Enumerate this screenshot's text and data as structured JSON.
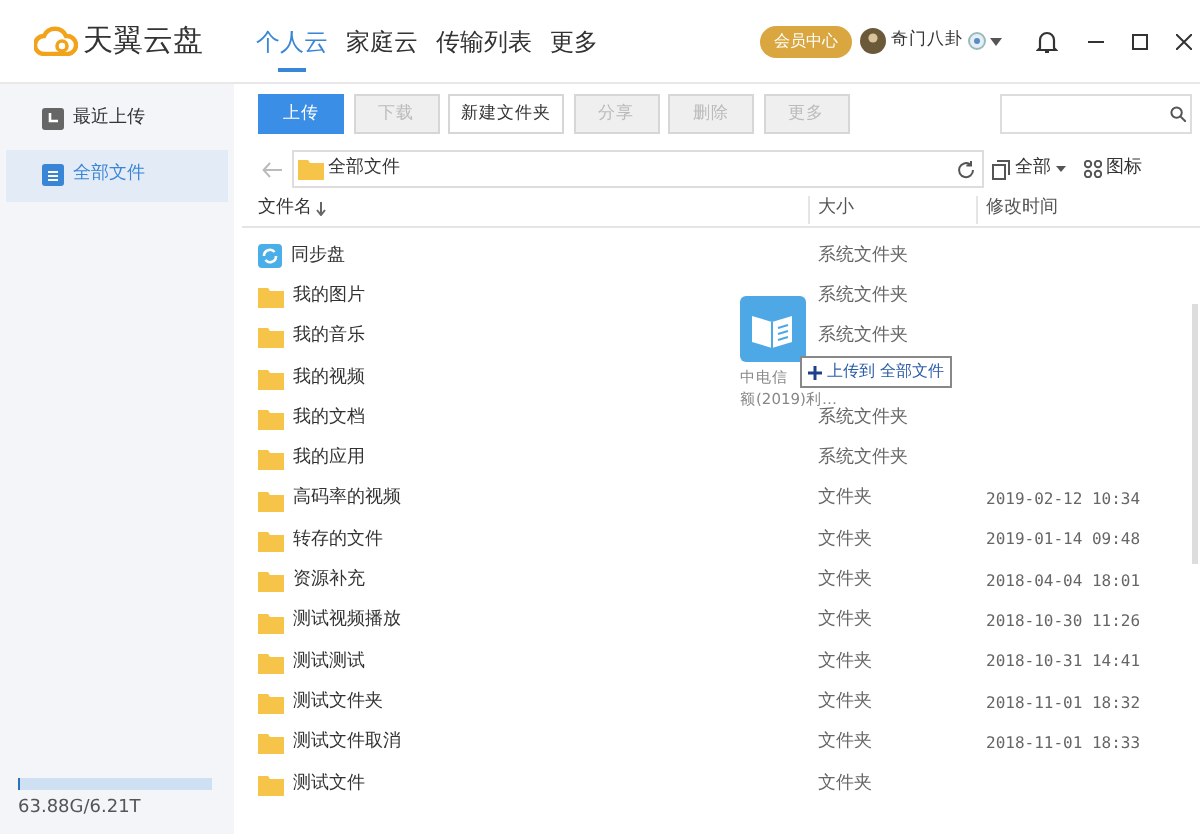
{
  "app": {
    "title": "天翼云盘"
  },
  "nav_tabs": [
    {
      "label": "个人云",
      "selected": true
    },
    {
      "label": "家庭云",
      "selected": false
    },
    {
      "label": "传输列表",
      "selected": false
    },
    {
      "label": "更多",
      "selected": false
    }
  ],
  "vip_button": "会员中心",
  "user": {
    "name": "奇门八卦"
  },
  "sidebar": {
    "items": [
      {
        "label": "最近上传",
        "kind": "recent",
        "selected": false
      },
      {
        "label": "全部文件",
        "kind": "files",
        "selected": true
      }
    ],
    "storage": {
      "level": 0.01,
      "text": "63.88G/6.21T"
    }
  },
  "toolbar": {
    "buttons": [
      {
        "label": "上传",
        "kind": "primary",
        "disabled": false
      },
      {
        "label": "下载",
        "kind": "plain",
        "disabled": true
      },
      {
        "label": "新建文件夹",
        "kind": "plain",
        "disabled": false
      },
      {
        "label": "分享",
        "kind": "plain",
        "disabled": true
      },
      {
        "label": "删除",
        "kind": "plain",
        "disabled": true
      },
      {
        "label": "更多",
        "kind": "plain",
        "disabled": true
      }
    ]
  },
  "path": "全部文件",
  "filter": "全部",
  "view": "图标",
  "table": {
    "columns": [
      {
        "label": "文件名",
        "sorted": true
      },
      {
        "label": "大小",
        "sorted": false
      },
      {
        "label": "修改时间",
        "sorted": false
      }
    ],
    "rows": [
      {
        "name": "同步盘",
        "kind": "sync",
        "size": "系统文件夹",
        "modified": ""
      },
      {
        "name": "我的图片",
        "kind": "folder",
        "size": "系统文件夹",
        "modified": ""
      },
      {
        "name": "我的音乐",
        "kind": "folder",
        "size": "系统文件夹",
        "modified": ""
      },
      {
        "name": "我的视频",
        "kind": "folder",
        "size": "",
        "modified": ""
      },
      {
        "name": "我的文档",
        "kind": "folder",
        "size": "系统文件夹",
        "modified": ""
      },
      {
        "name": "我的应用",
        "kind": "folder",
        "size": "系统文件夹",
        "modified": ""
      },
      {
        "name": "高码率的视频",
        "kind": "folder",
        "size": "文件夹",
        "modified": "2019-02-12 10:34"
      },
      {
        "name": "转存的文件",
        "kind": "folder",
        "size": "文件夹",
        "modified": "2019-01-14 09:48"
      },
      {
        "name": "资源补充",
        "kind": "folder",
        "size": "文件夹",
        "modified": "2018-04-04 18:01"
      },
      {
        "name": "测试视频播放",
        "kind": "folder",
        "size": "文件夹",
        "modified": "2018-10-30 11:26"
      },
      {
        "name": "测试测试",
        "kind": "folder",
        "size": "文件夹",
        "modified": "2018-10-31 14:41"
      },
      {
        "name": "测试文件夹",
        "kind": "folder",
        "size": "文件夹",
        "modified": "2018-11-01 18:32"
      },
      {
        "name": "测试文件取消",
        "kind": "folder",
        "size": "文件夹",
        "modified": "2018-11-01 18:33"
      },
      {
        "name": "测试文件",
        "kind": "folder",
        "size": "文件夹",
        "modified": ""
      }
    ]
  },
  "drag": {
    "label_lines": [
      "中电信",
      "额(2019)利…"
    ],
    "tooltip": "上传到 全部文件"
  }
}
